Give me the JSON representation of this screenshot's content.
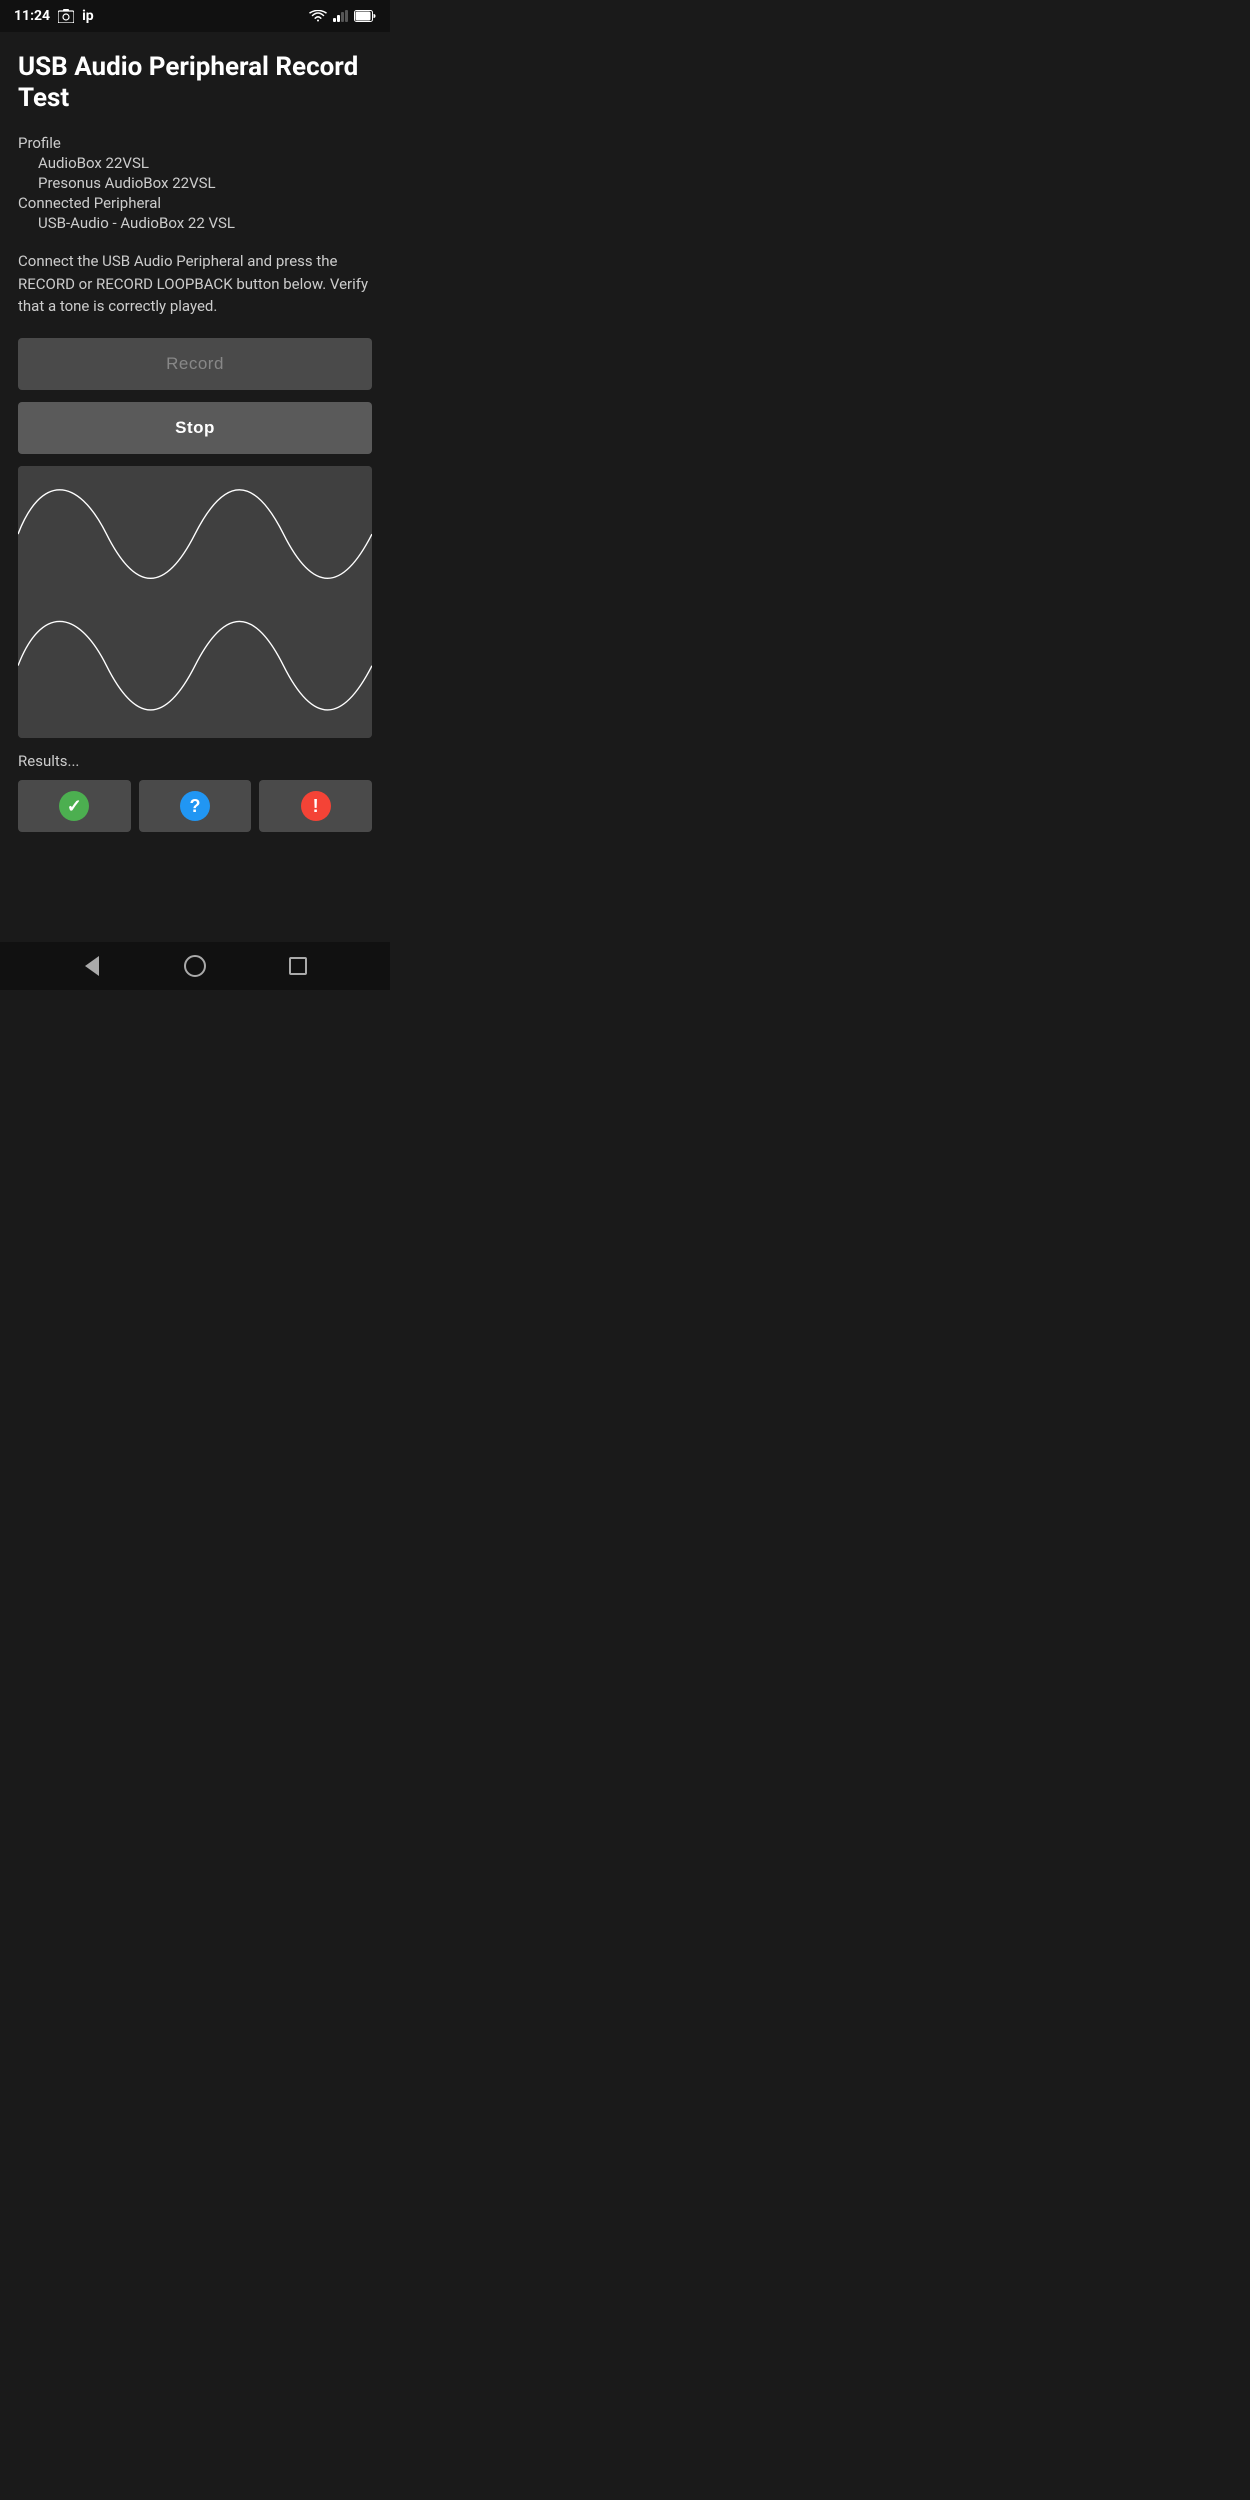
{
  "statusBar": {
    "time": "11:24",
    "notifLabel": "ip"
  },
  "page": {
    "title": "USB Audio Peripheral Record Test",
    "profile": {
      "label": "Profile",
      "line1": "AudioBox 22VSL",
      "line2": "Presonus AudioBox 22VSL"
    },
    "connectedPeripheral": {
      "label": "Connected Peripheral",
      "device": "USB-Audio - AudioBox 22 VSL"
    },
    "description": "Connect the USB Audio Peripheral and press the RECORD or RECORD LOOPBACK button below. Verify that a tone is correctly played.",
    "buttons": {
      "record": "Record",
      "stop": "Stop"
    },
    "results": {
      "label": "Results...",
      "checkIcon": "✓",
      "questionIcon": "?",
      "exclaimIcon": "!"
    }
  },
  "navBar": {
    "back": "back",
    "home": "home",
    "recent": "recent"
  }
}
